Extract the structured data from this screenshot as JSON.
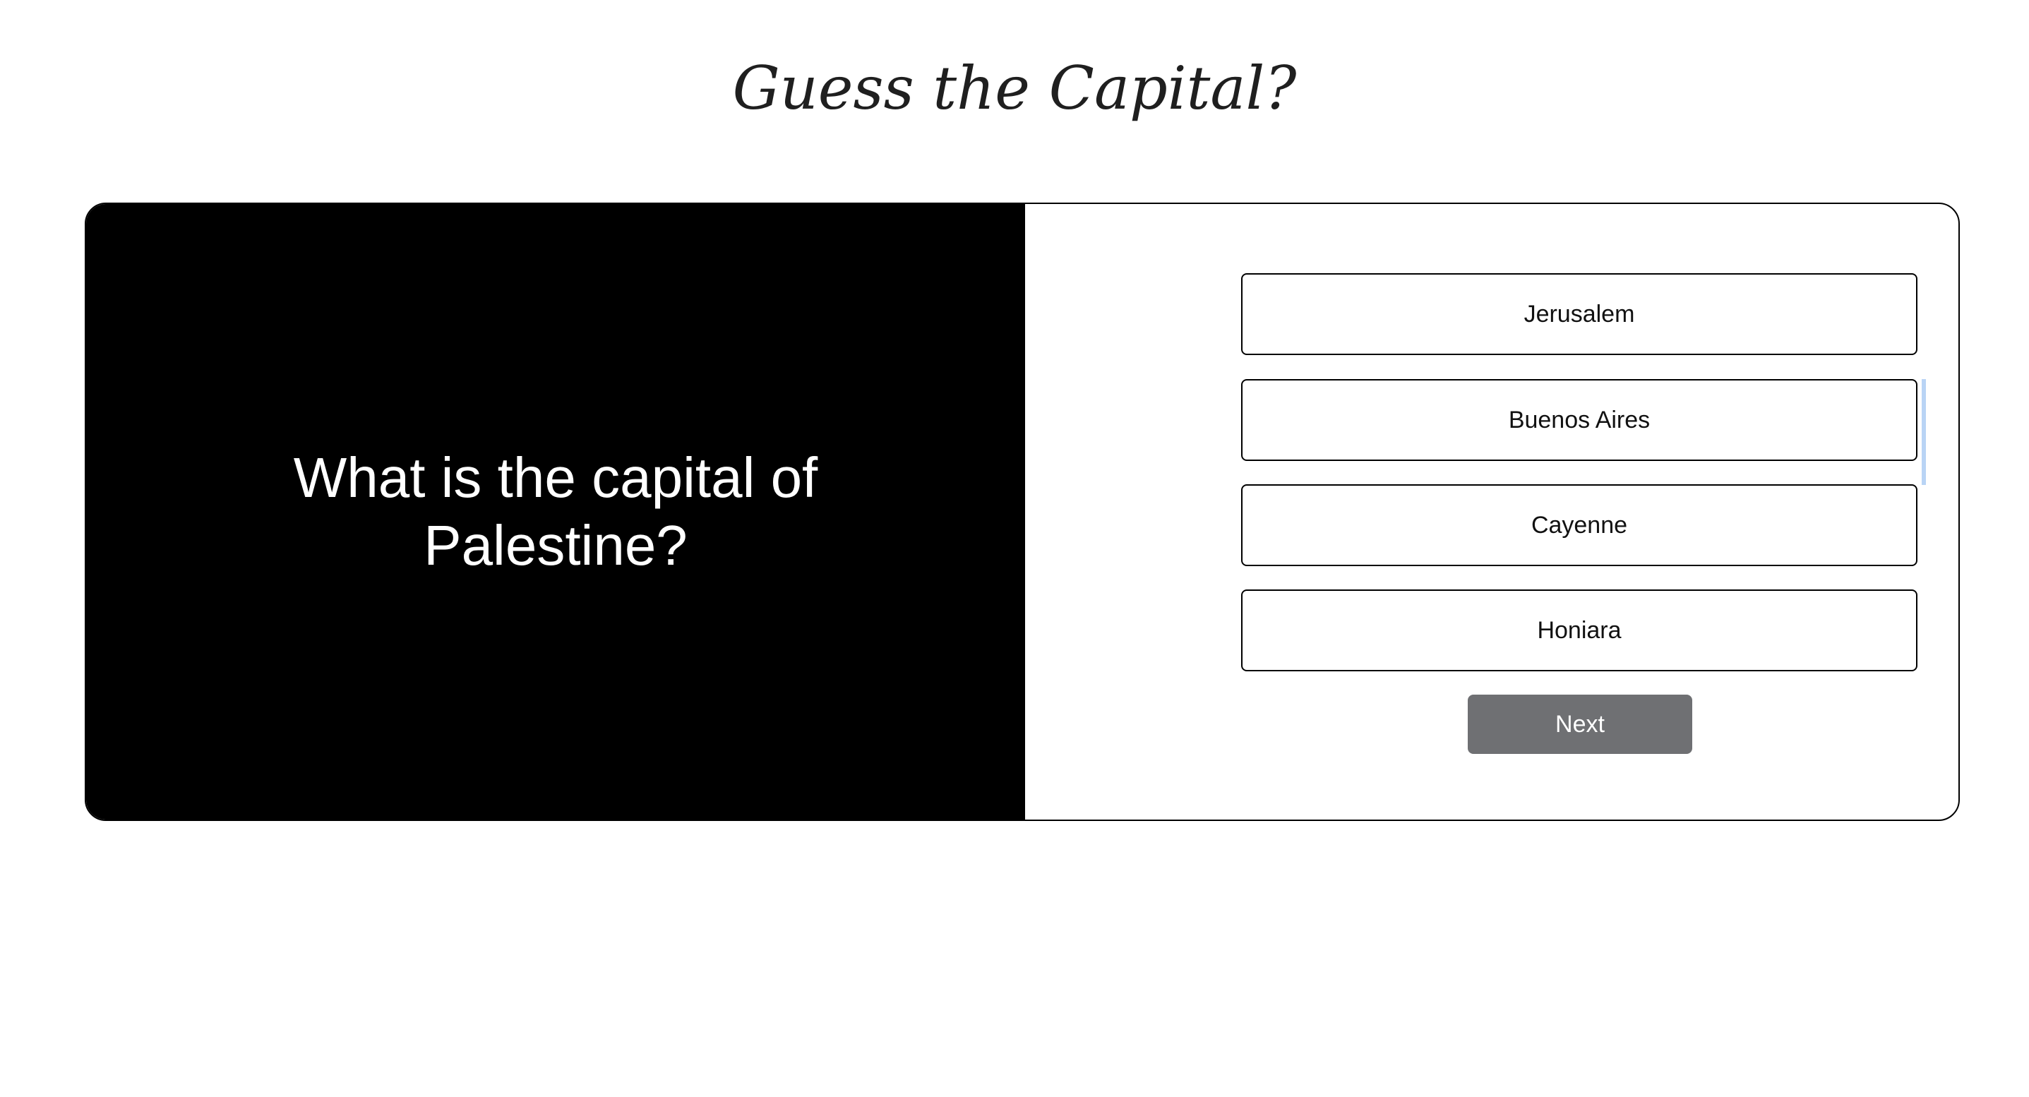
{
  "title": "Guess the Capital?",
  "question": {
    "text": "What is the capital of Palestine?"
  },
  "answers": [
    {
      "label": "Jerusalem"
    },
    {
      "label": "Buenos Aires"
    },
    {
      "label": "Cayenne"
    },
    {
      "label": "Honiara"
    }
  ],
  "next_button": {
    "label": "Next"
  },
  "colors": {
    "question_panel_bg": "#000000",
    "next_button_bg": "#6f7073",
    "focus_highlight": "#b9d4f5"
  }
}
